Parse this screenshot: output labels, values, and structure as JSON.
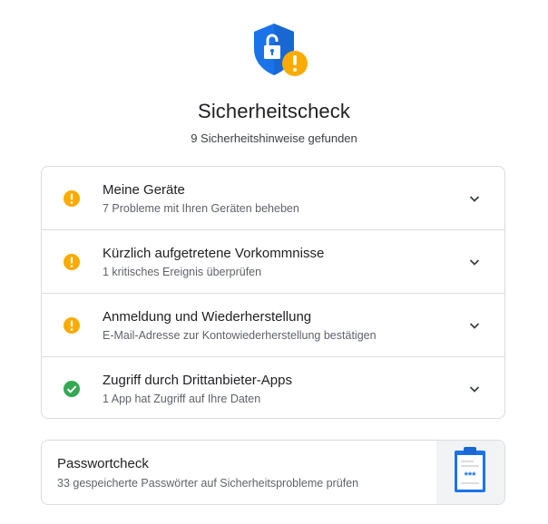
{
  "header": {
    "icon": "shield-lock-warning-icon",
    "title": "Sicherheitscheck",
    "subtitle": "9 Sicherheitshinweise gefunden"
  },
  "issues": [
    {
      "status": "warning",
      "icon": "warning-icon",
      "title": "Meine Geräte",
      "description": "7 Probleme mit Ihren Geräten beheben"
    },
    {
      "status": "warning",
      "icon": "warning-icon",
      "title": "Kürzlich aufgetretene Vorkommnisse",
      "description": "1 kritisches Ereignis überprüfen"
    },
    {
      "status": "warning",
      "icon": "warning-icon",
      "title": "Anmeldung und Wiederherstellung",
      "description": "E-Mail-Adresse zur Kontowiederherstellung bestätigen"
    },
    {
      "status": "ok",
      "icon": "check-circle-icon",
      "title": "Zugriff durch Drittanbieter-Apps",
      "description": "1 App hat Zugriff auf Ihre Daten"
    }
  ],
  "password_check": {
    "title": "Passwortcheck",
    "description": "33 gespeicherte Passwörter auf Sicherheitsprobleme prüfen",
    "illustration": "clipboard-password-icon",
    "illustration_text": "***"
  },
  "colors": {
    "warning": "#f9ab00",
    "ok": "#34a853",
    "shield": "#1a73e8",
    "border": "#dadce0",
    "secondary_text": "#5f6368"
  }
}
